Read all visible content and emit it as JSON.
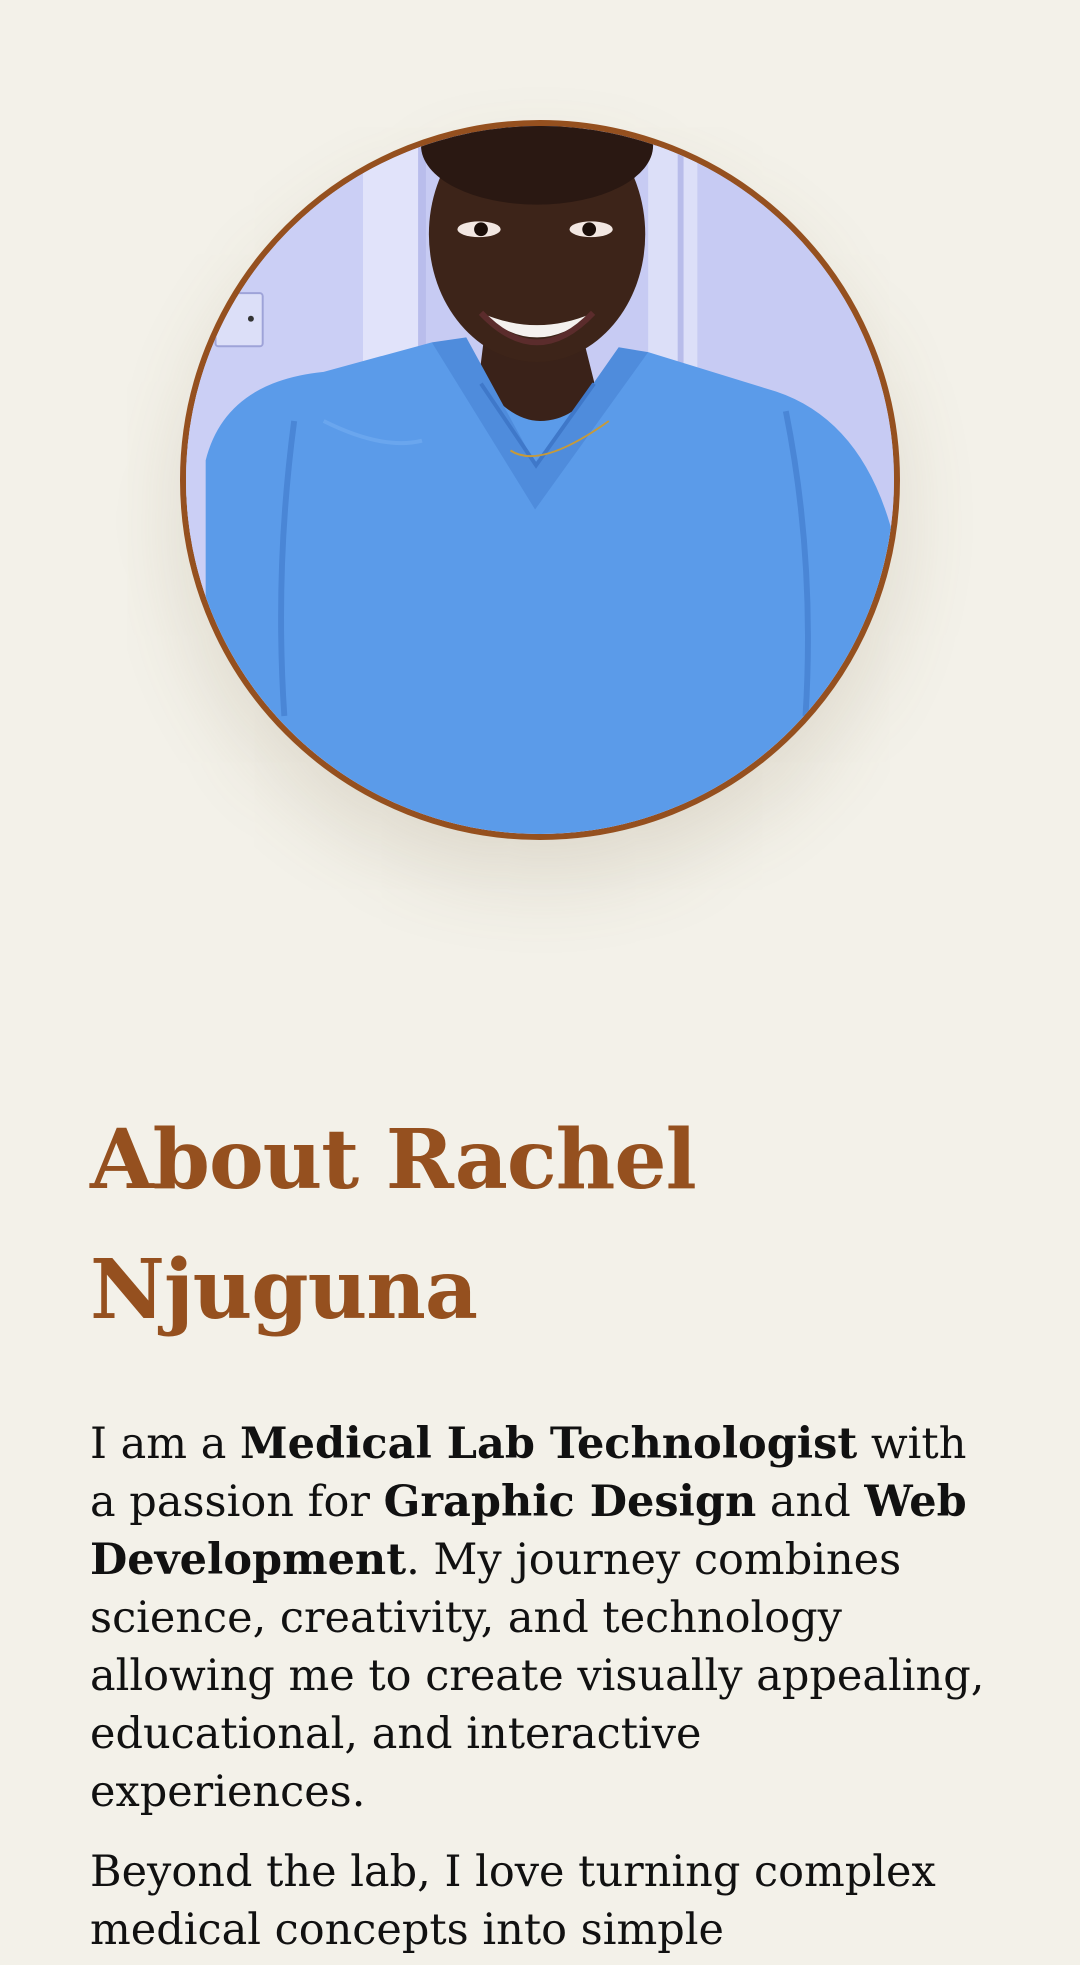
{
  "profile": {
    "image_alt": "Rachel Njuguna",
    "border_color": "#95501f"
  },
  "about": {
    "title_line1": "About Rachel",
    "title_line2": "Njuguna",
    "intro": {
      "t1": "I am a ",
      "b1": "Medical Lab Technologist",
      "t2": " with a passion for ",
      "b2": "Graphic Design",
      "t3": " and ",
      "b3": "Web Development",
      "t4": ". My journey combines science, creativity, and technology allowing me to create visually appealing, educational, and interactive experiences."
    },
    "paragraph2": "Beyond the lab, I love turning complex medical concepts into simple"
  },
  "colors": {
    "background": "#f3f1e9",
    "accent": "#95501f",
    "text": "#111111"
  }
}
